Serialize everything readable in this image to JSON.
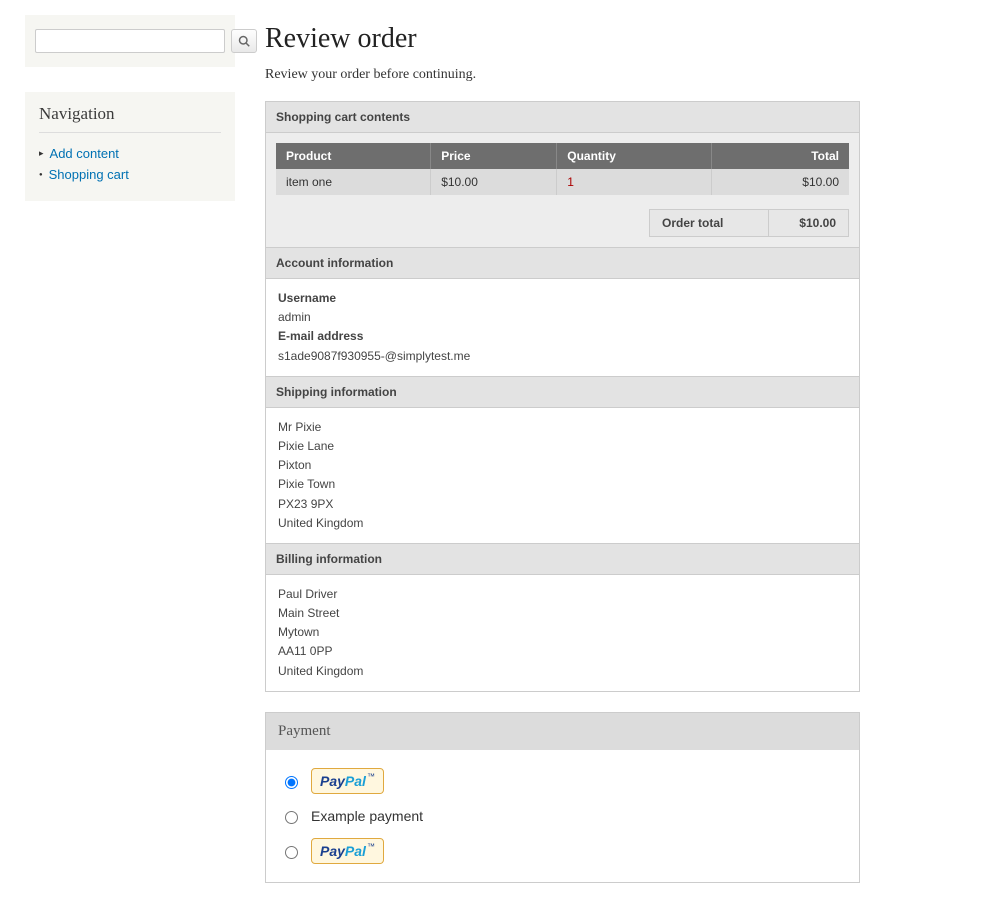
{
  "sidebar": {
    "nav_title": "Navigation",
    "links": [
      {
        "label": "Add content"
      },
      {
        "label": "Shopping cart"
      }
    ]
  },
  "page": {
    "title": "Review order",
    "subtitle": "Review your order before continuing."
  },
  "cart": {
    "section_title": "Shopping cart contents",
    "headers": {
      "product": "Product",
      "price": "Price",
      "quantity": "Quantity",
      "total": "Total"
    },
    "rows": [
      {
        "product": "item one",
        "price": "$10.00",
        "quantity": "1",
        "total": "$10.00"
      }
    ],
    "order_total_label": "Order total",
    "order_total_value": "$10.00"
  },
  "account": {
    "section_title": "Account information",
    "username_label": "Username",
    "username": "admin",
    "email_label": "E-mail address",
    "email": "s1ade9087f930955-@simplytest.me"
  },
  "shipping": {
    "section_title": "Shipping information",
    "lines": [
      "Mr Pixie",
      "Pixie Lane",
      "Pixton",
      "Pixie Town",
      "PX23 9PX",
      "United Kingdom"
    ]
  },
  "billing": {
    "section_title": "Billing information",
    "lines": [
      "Paul Driver",
      "Main Street",
      "Mytown",
      "AA11 0PP",
      "United Kingdom"
    ]
  },
  "payment": {
    "section_title": "Payment",
    "options": [
      {
        "type": "paypal",
        "selected": true
      },
      {
        "type": "text",
        "label": "Example payment",
        "selected": false
      },
      {
        "type": "paypal",
        "selected": false
      }
    ]
  }
}
